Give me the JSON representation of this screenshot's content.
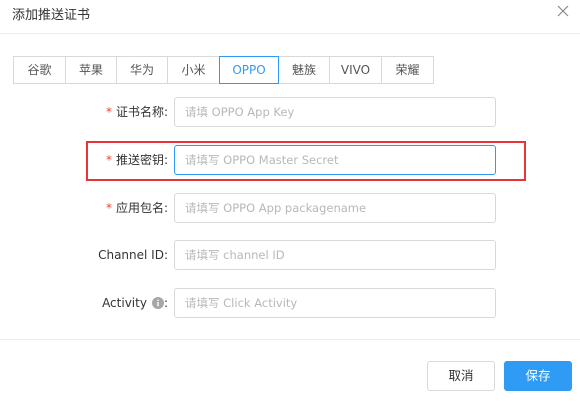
{
  "dialog": {
    "title": "添加推送证书"
  },
  "tabs": [
    {
      "label": "谷歌",
      "active": false
    },
    {
      "label": "苹果",
      "active": false
    },
    {
      "label": "华为",
      "active": false
    },
    {
      "label": "小米",
      "active": false
    },
    {
      "label": "OPPO",
      "active": true
    },
    {
      "label": "魅族",
      "active": false
    },
    {
      "label": "VIVO",
      "active": false
    },
    {
      "label": "荣耀",
      "active": false
    }
  ],
  "form": {
    "cert_name": {
      "required_mark": "*",
      "label": "证书名称:",
      "value": "",
      "placeholder": "请填 OPPO App Key"
    },
    "master_secret": {
      "required_mark": "*",
      "label": "推送密钥:",
      "value": "",
      "placeholder": "请填写 OPPO Master Secret"
    },
    "package_name": {
      "required_mark": "*",
      "label": "应用包名:",
      "value": "",
      "placeholder": "请填写 OPPO App packagename"
    },
    "channel_id": {
      "label": "Channel ID:",
      "value": "",
      "placeholder": "请填写 channel ID"
    },
    "activity": {
      "label": "Activity",
      "colon": ":",
      "value": "",
      "placeholder": "请填写 Click Activity"
    }
  },
  "footer": {
    "cancel_label": "取消",
    "save_label": "保存"
  },
  "colors": {
    "accent": "#2f9bf4",
    "required": "#f04134",
    "highlight": "#e63538"
  },
  "icons": {
    "close": "close-icon",
    "info": "info-circle-icon"
  }
}
